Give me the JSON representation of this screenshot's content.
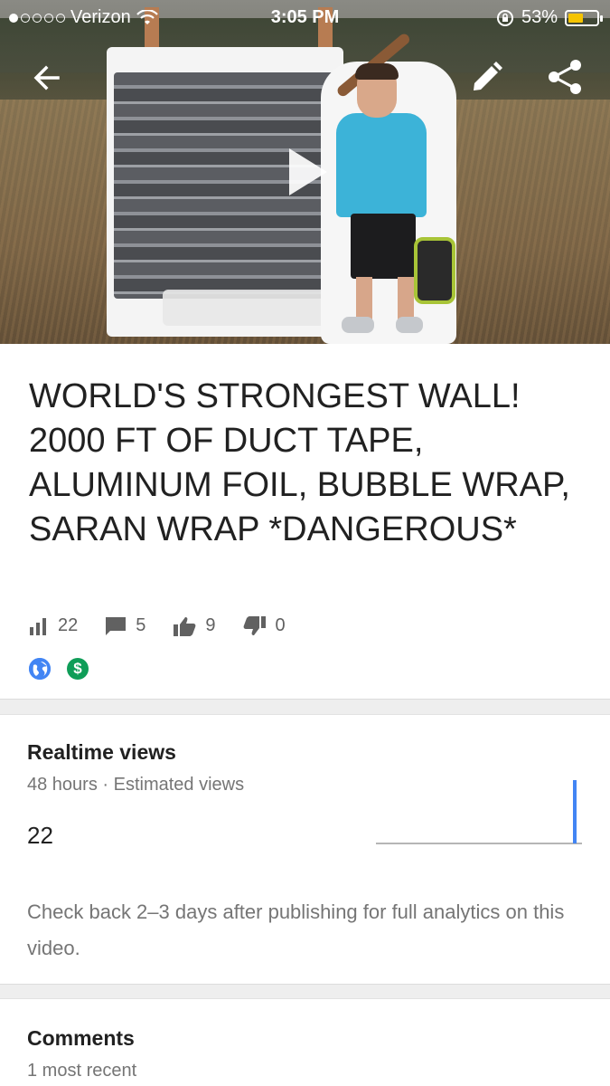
{
  "status_bar": {
    "carrier": "Verizon",
    "time": "3:05 PM",
    "battery": "53%",
    "battery_level": 0.53,
    "signal_bars_filled": 1,
    "signal_bars_total": 5
  },
  "header": {
    "back_icon": "arrow-left-icon",
    "edit_icon": "pencil-icon",
    "share_icon": "share-icon",
    "play_icon": "play-icon"
  },
  "video": {
    "title": "WORLD'S STRONGEST WALL! 2000 FT OF DUCT TAPE, ALUMINUM FOIL, BUBBLE WRAP,  SARAN WRAP *DANGEROUS*",
    "stats": {
      "views": "22",
      "comments": "5",
      "likes": "9",
      "dislikes": "0"
    },
    "badges": {
      "visibility_icon": "globe-icon",
      "monetization_icon": "dollar-icon",
      "visibility_color": "#4285f4",
      "monetization_color": "#0f9d58"
    }
  },
  "realtime": {
    "title": "Realtime views",
    "subtitle": "48 hours · Estimated views",
    "value": "22",
    "note": "Check back 2–3 days after publishing for full analytics on this video.",
    "accent": "#4285f4"
  },
  "comments": {
    "title": "Comments",
    "subtitle": "1 most recent"
  }
}
